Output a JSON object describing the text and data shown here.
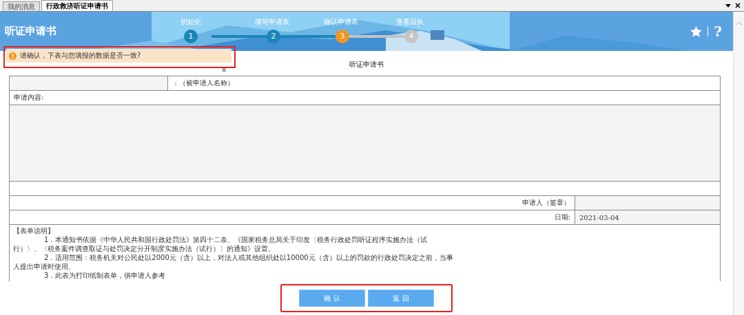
{
  "tabs": [
    {
      "label": "我的消息",
      "selected": false
    },
    {
      "label": "行政救济听证申请书",
      "selected": true
    }
  ],
  "header": {
    "title": "听证申请书",
    "steps": [
      {
        "label": "初始化",
        "number": "1",
        "completed": true,
        "selected": false
      },
      {
        "label": "填写申请表",
        "number": "2",
        "completed": true,
        "selected": false
      },
      {
        "label": "确认申请表",
        "number": "3",
        "completed": false,
        "selected": true
      },
      {
        "label": "查看回执",
        "number": "4",
        "completed": false,
        "selected": false
      }
    ],
    "help": "?"
  },
  "alert": {
    "message": "请确认，下表与您填报的数据是否一致?",
    "close": "×"
  },
  "form": {
    "title": "听证申请书",
    "respondent_label": "：（被申请人名称）",
    "content_label": "申请内容:",
    "signature_label": "申请人（签章）",
    "date_label": "日期:",
    "date_value": "2021-03-04",
    "notes_title": "【表单说明】",
    "notes": [
      "1．本通知书依据《中华人民共和国行政处罚法》第四十二条、《国家税务总局关于印发〈税务行政处罚听证程序实施办法（试行）〉、〈税务案件调查取证与处罚决定分开制度实施办法（试行）〉的通知》设置。",
      "2．适用范围：税务机关对公民处以2000元（含）以上，对法人或其他组织处以10000元（含）以上的罚款的行政处罚决定之前，当事人提出申请时使用。",
      "3．此表为打印纸制表单，供申请人参考"
    ]
  },
  "buttons": [
    "确 认",
    "返 回"
  ]
}
